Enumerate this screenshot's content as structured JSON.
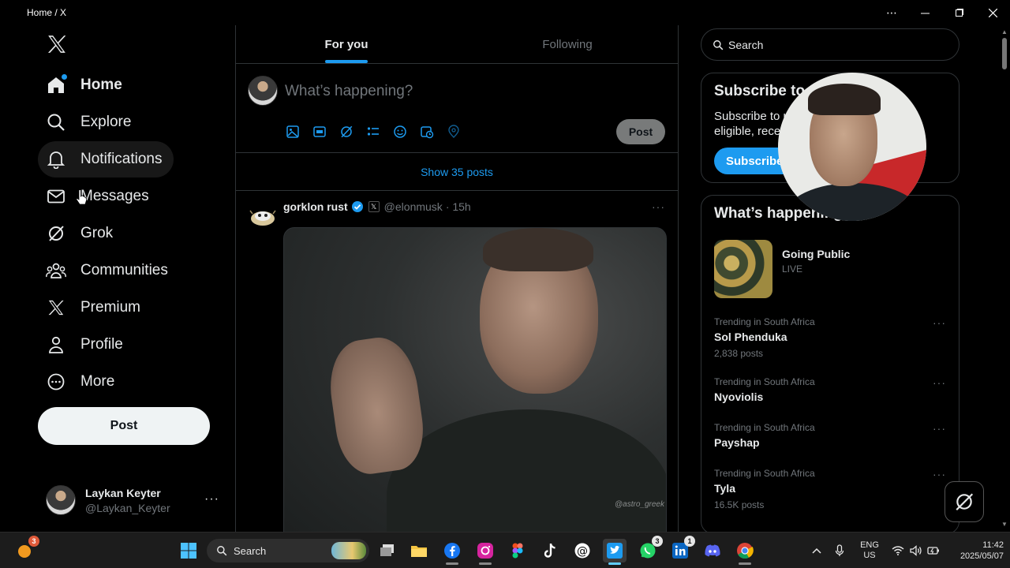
{
  "window": {
    "title": "Home / X"
  },
  "nav": {
    "items": [
      {
        "label": "Home",
        "icon": "home-icon"
      },
      {
        "label": "Explore",
        "icon": "search-icon"
      },
      {
        "label": "Notifications",
        "icon": "bell-icon"
      },
      {
        "label": "Messages",
        "icon": "envelope-icon"
      },
      {
        "label": "Grok",
        "icon": "grok-icon"
      },
      {
        "label": "Communities",
        "icon": "people-icon"
      },
      {
        "label": "Premium",
        "icon": "x-logo-icon"
      },
      {
        "label": "Profile",
        "icon": "person-icon"
      },
      {
        "label": "More",
        "icon": "more-circle-icon"
      }
    ],
    "post_label": "Post",
    "account": {
      "name": "Laykan Keyter",
      "handle": "@Laykan_Keyter"
    }
  },
  "feed": {
    "tabs": [
      "For you",
      "Following"
    ],
    "composer": {
      "placeholder": "What’s happening?",
      "post_label": "Post"
    },
    "show_posts": "Show 35 posts",
    "tweet": {
      "name": "gorklon rust",
      "handle": "@elonmusk",
      "time": "· 15h",
      "watermark": "@astro_greek"
    }
  },
  "sidebar": {
    "search_placeholder": "Search",
    "subscribe": {
      "title": "Subscribe to",
      "text_line1": "Subscribe to u",
      "text_line2": "eligible, recei",
      "button": "Subscribe"
    },
    "happening": {
      "title": "What’s happening",
      "live": {
        "title": "Going Public",
        "status": "LIVE"
      },
      "trends": [
        {
          "context": "Trending in South Africa",
          "topic": "Sol Phenduka",
          "posts": "2,838 posts"
        },
        {
          "context": "Trending in South Africa",
          "topic": "Nyoviolis",
          "posts": ""
        },
        {
          "context": "Trending in South Africa",
          "topic": "Payshap",
          "posts": ""
        },
        {
          "context": "Trending in South Africa",
          "topic": "Tyla",
          "posts": "16.5K posts"
        }
      ]
    }
  },
  "taskbar": {
    "search_label": "Search",
    "badges": {
      "weather": "3",
      "whatsapp": "3",
      "linkedin": "1"
    },
    "lang": {
      "line1": "ENG",
      "line2": "US"
    },
    "clock": {
      "time": "11:42",
      "date": "2025/05/07"
    }
  },
  "colors": {
    "accent": "#1d9bf0",
    "background": "#000000",
    "border": "#2f3336",
    "muted": "#71767b"
  }
}
